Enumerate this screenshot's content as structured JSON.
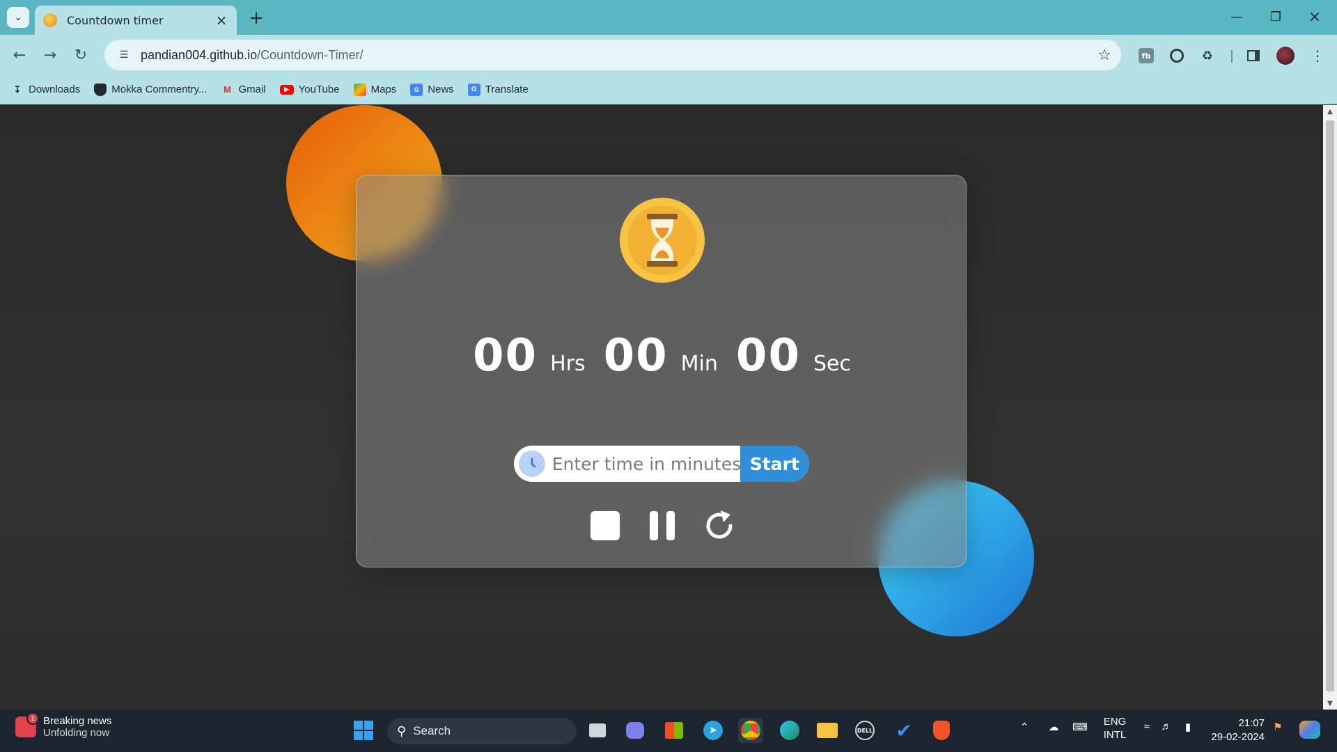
{
  "browser": {
    "tab_title": "Countdown timer",
    "address": {
      "domain": "pandian004.github.io",
      "path": "/Countdown-Timer/"
    },
    "bookmarks": [
      {
        "label": "Downloads",
        "icon": "download-icon"
      },
      {
        "label": "Mokka Commentry...",
        "icon": "shield-icon"
      },
      {
        "label": "Gmail",
        "icon": "gmail-icon"
      },
      {
        "label": "YouTube",
        "icon": "youtube-icon"
      },
      {
        "label": "Maps",
        "icon": "maps-icon"
      },
      {
        "label": "News",
        "icon": "news-icon"
      },
      {
        "label": "Translate",
        "icon": "translate-icon"
      }
    ]
  },
  "timer": {
    "hours": "00",
    "hours_unit": "Hrs",
    "minutes": "00",
    "minutes_unit": "Min",
    "seconds": "00",
    "seconds_unit": "Sec",
    "input_placeholder": "Enter time in minutes",
    "start_label": "Start",
    "controls": [
      "stop-icon",
      "pause-icon",
      "restart-icon"
    ]
  },
  "colors": {
    "orange_blob": "#f0a61b",
    "blue_blob": "#1f7fd6",
    "start_button": "#2f8fd8",
    "browser_frame": "#5ab7c1"
  },
  "taskbar": {
    "news_title": "Breaking news",
    "news_subtitle": "Unfolding now",
    "news_badge": "1",
    "search_label": "Search",
    "lang_line1": "ENG",
    "lang_line2": "INTL",
    "time": "21:07",
    "date": "29-02-2024"
  }
}
